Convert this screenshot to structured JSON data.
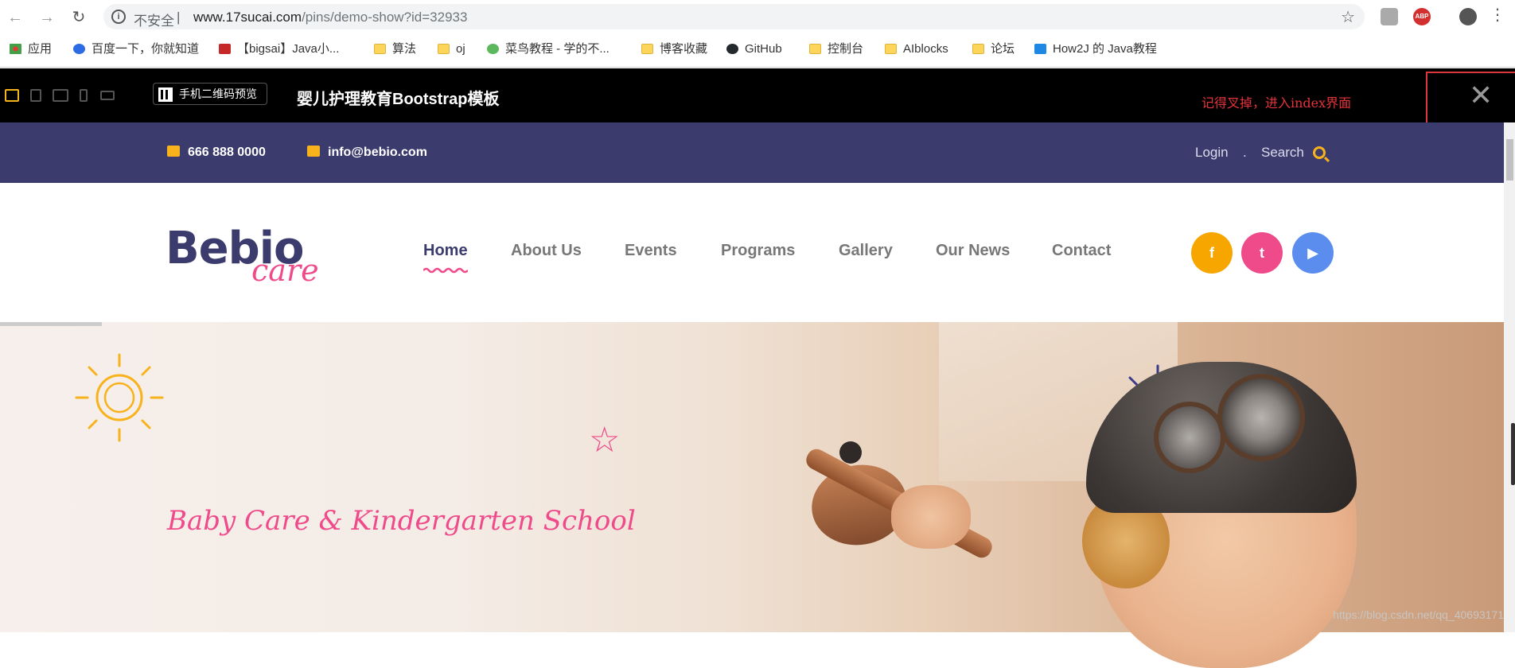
{
  "browser": {
    "security_text": "不安全",
    "url_host": "www.17sucai.com",
    "url_path": "/pins/demo-show?id=32933",
    "abp_label": "ABP"
  },
  "bookmarks": [
    {
      "label": "应用"
    },
    {
      "label": "百度一下，你就知道"
    },
    {
      "label": "【bigsai】Java小..."
    },
    {
      "label": "算法"
    },
    {
      "label": "oj"
    },
    {
      "label": "菜鸟教程 - 学的不..."
    },
    {
      "label": "博客收藏"
    },
    {
      "label": "GitHub"
    },
    {
      "label": "控制台"
    },
    {
      "label": "AIblocks"
    },
    {
      "label": "论坛"
    },
    {
      "label": "How2J 的 Java教程"
    }
  ],
  "demobar": {
    "qr_label": "手机二维码预览",
    "title": "婴儿护理教育Bootstrap模板",
    "annotation": "记得叉掉，进入index界面",
    "close_label": "✕"
  },
  "topbar": {
    "phone": "666 888 0000",
    "email": "info@bebio.com",
    "login": "Login",
    "separator": ".",
    "search": "Search"
  },
  "header": {
    "logo_main": "Bebio",
    "logo_sub": "care",
    "nav": [
      {
        "label": "Home"
      },
      {
        "label": "About Us"
      },
      {
        "label": "Events"
      },
      {
        "label": "Programs"
      },
      {
        "label": "Gallery"
      },
      {
        "label": "Our News"
      },
      {
        "label": "Contact"
      }
    ],
    "social": [
      {
        "label": "f",
        "color": "#f7a600"
      },
      {
        "label": "t",
        "color": "#ef4b8b"
      },
      {
        "label": "▶",
        "color": "#5b8def"
      }
    ]
  },
  "hero": {
    "tagline": "Baby Care & Kindergarten School"
  },
  "watermark": "https://blog.csdn.net/qq_40693171",
  "colors": {
    "brand_navy": "#3b3b6e",
    "brand_pink": "#ef4b8b",
    "accent_yellow": "#f7b21c",
    "annotation_red": "#e5333a"
  }
}
